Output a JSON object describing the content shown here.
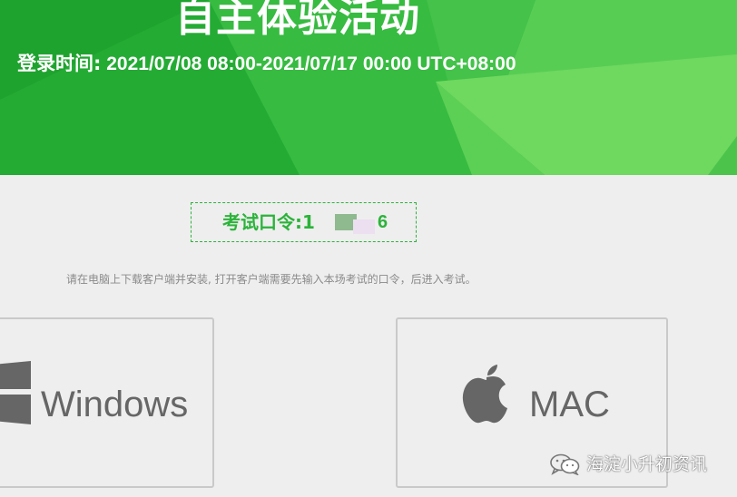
{
  "banner": {
    "title": "自主体验活动",
    "login_label": "登录时间:",
    "login_range": " 2021/07/08 08:00-2021/07/17 00:00 UTC+08:00"
  },
  "exam_code": {
    "label": "考试口令:1",
    "last_digit": "6"
  },
  "hint": "请在电脑上下载客户端并安装, 打开客户端需要先输入本场考试的口令，后进入考试。",
  "downloads": {
    "windows": {
      "label": "Windows",
      "icon": "windows-logo-icon"
    },
    "mac": {
      "label": "MAC",
      "icon": "apple-logo-icon"
    }
  },
  "watermark": {
    "icon": "wechat-icon",
    "text": "海淀小升初资讯"
  },
  "colors": {
    "accent": "#2bb33a",
    "banner_light": "#6fd85f",
    "background": "#eeeeee",
    "icon_gray": "#666666"
  }
}
